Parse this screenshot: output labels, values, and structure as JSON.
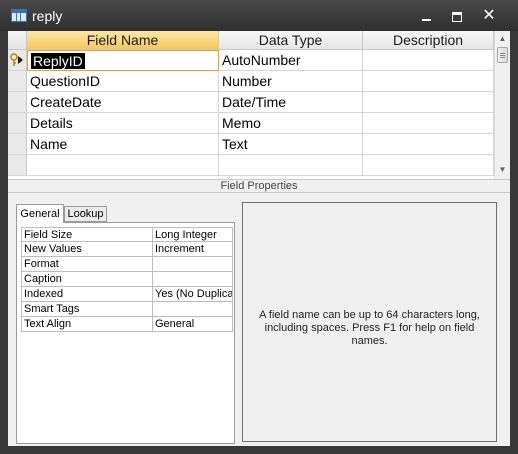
{
  "window": {
    "title": "reply",
    "title_icon": "table-icon",
    "minimize": "minimize-icon",
    "maximize": "maximize-icon",
    "close_glyph": "✕"
  },
  "grid": {
    "columns": {
      "field_name": "Field Name",
      "data_type": "Data Type",
      "description": "Description"
    },
    "rows": [
      {
        "field_name": "ReplyID",
        "data_type": "AutoNumber",
        "description": "",
        "primary_key": true,
        "selected": true
      },
      {
        "field_name": "QuestionID",
        "data_type": "Number",
        "description": ""
      },
      {
        "field_name": "CreateDate",
        "data_type": "Date/Time",
        "description": ""
      },
      {
        "field_name": "Details",
        "data_type": "Memo",
        "description": ""
      },
      {
        "field_name": "Name",
        "data_type": "Text",
        "description": ""
      },
      {
        "field_name": "",
        "data_type": "",
        "description": ""
      }
    ]
  },
  "field_properties_label": "Field Properties",
  "tabs": {
    "general": "General",
    "lookup": "Lookup"
  },
  "properties": [
    {
      "name": "Field Size",
      "value": "Long Integer"
    },
    {
      "name": "New Values",
      "value": "Increment"
    },
    {
      "name": "Format",
      "value": ""
    },
    {
      "name": "Caption",
      "value": ""
    },
    {
      "name": "Indexed",
      "value": "Yes (No Duplica"
    },
    {
      "name": "Smart Tags",
      "value": ""
    },
    {
      "name": "Text Align",
      "value": "General"
    }
  ],
  "help_text": "A field name can be up to 64 characters long, including spaces.  Press F1 for help on field names.",
  "colors": {
    "header_active": "#f6c85c",
    "title_bar": "#383838",
    "selection": "#000000"
  }
}
